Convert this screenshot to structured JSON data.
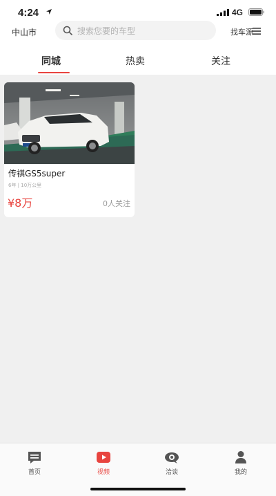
{
  "status_bar": {
    "time": "4:24",
    "network": "4G"
  },
  "header": {
    "city": "中山市",
    "search_placeholder": "搜索您要的车型",
    "find_car_label": "找车源"
  },
  "tabs": [
    {
      "label": "同城",
      "active": true
    },
    {
      "label": "热卖",
      "active": false
    },
    {
      "label": "关注",
      "active": false
    }
  ],
  "listing": {
    "title": "传祺GS5super",
    "meta": "6年 | 10万公里",
    "price": "¥8万",
    "followers": "0人关注",
    "image_icon": "car-photo"
  },
  "tabbar": [
    {
      "label": "首页",
      "icon": "home-chat-icon",
      "active": false
    },
    {
      "label": "视频",
      "icon": "video-play-icon",
      "active": true
    },
    {
      "label": "洽谈",
      "icon": "eye-chat-icon",
      "active": false
    },
    {
      "label": "我的",
      "icon": "user-icon",
      "active": false
    }
  ],
  "colors": {
    "accent": "#e8443f",
    "background": "#f0f0f0"
  }
}
